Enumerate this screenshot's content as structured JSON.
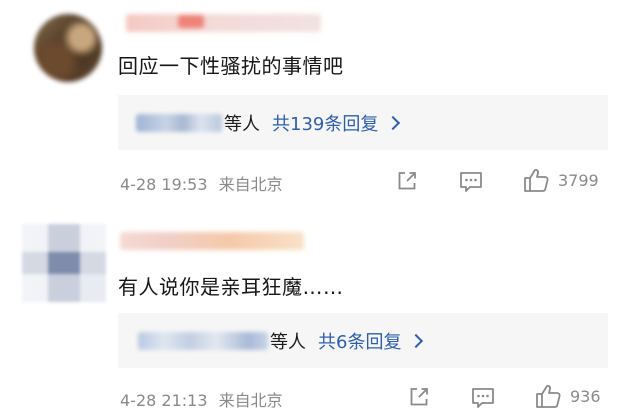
{
  "comments": [
    {
      "text": "回应一下性骚扰的事情吧",
      "replies": {
        "users_suffix": "等人",
        "count_label": "共139条回复"
      },
      "meta": {
        "time": "4-28 19:53",
        "location": "来自北京"
      },
      "likes": "3799"
    },
    {
      "text": "有人说你是亲耳狂魔……",
      "replies": {
        "users_suffix": "等人",
        "count_label": "共6条回复"
      },
      "meta": {
        "time": "4-28 21:13",
        "location": "来自北京"
      },
      "likes": "936"
    }
  ],
  "icons": {
    "share": "share-icon",
    "comment": "comment-icon",
    "like": "thumbs-up-icon",
    "chevron": "chevron-right-icon"
  },
  "colors": {
    "link": "#2f5fa7",
    "meta": "#8a8a8a",
    "reply_bg": "#f6f6f6"
  }
}
